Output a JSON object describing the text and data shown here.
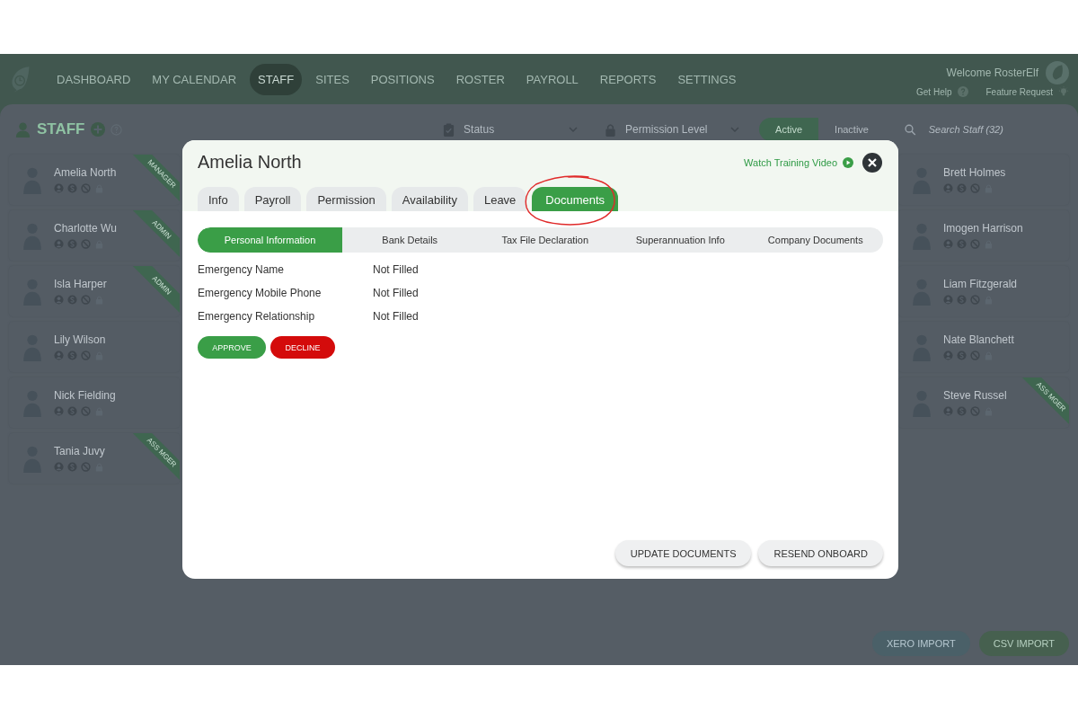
{
  "nav": {
    "items": [
      {
        "label": "DASHBOARD",
        "selected": false
      },
      {
        "label": "MY CALENDAR",
        "selected": false
      },
      {
        "label": "STAFF",
        "selected": true
      },
      {
        "label": "SITES",
        "selected": false
      },
      {
        "label": "POSITIONS",
        "selected": false
      },
      {
        "label": "ROSTER",
        "selected": false
      },
      {
        "label": "PAYROLL",
        "selected": false
      },
      {
        "label": "REPORTS",
        "selected": false
      },
      {
        "label": "SETTINGS",
        "selected": false
      }
    ],
    "welcome": "Welcome RosterElf",
    "help": "Get Help",
    "feature_request": "Feature Request"
  },
  "staff_header": {
    "title": "STAFF",
    "status_filter": "Status",
    "permission_filter": "Permission Level",
    "toggle": [
      {
        "label": "Active",
        "selected": true
      },
      {
        "label": "Inactive",
        "selected": false
      }
    ],
    "search": {
      "placeholder": "Search Staff (32)"
    }
  },
  "staff_left": [
    {
      "name": "Amelia North",
      "ribbon": "MANAGER"
    },
    {
      "name": "Charlotte Wu",
      "ribbon": "ADMIN"
    },
    {
      "name": "Isla Harper",
      "ribbon": "ADMIN"
    },
    {
      "name": "Lily Wilson"
    },
    {
      "name": "Nick Fielding"
    },
    {
      "name": "Tania Juvy",
      "ribbon": "ASS MGER"
    }
  ],
  "staff_right": [
    {
      "name": "Brett Holmes"
    },
    {
      "name": "Imogen Harrison"
    },
    {
      "name": "Liam Fitzgerald"
    },
    {
      "name": "Nate Blanchett"
    },
    {
      "name": "Steve Russel",
      "ribbon": "ASS MGER"
    }
  ],
  "import_buttons": [
    {
      "label": "XERO IMPORT",
      "kind": "xero"
    },
    {
      "label": "CSV IMPORT",
      "kind": "csv"
    }
  ],
  "dialog": {
    "title": "Amelia North",
    "training_link": "Watch Training Video",
    "tabs": [
      {
        "label": "Info",
        "selected": false,
        "circled": false
      },
      {
        "label": "Payroll",
        "selected": false,
        "circled": false
      },
      {
        "label": "Permission",
        "selected": false,
        "circled": false
      },
      {
        "label": "Availability",
        "selected": false,
        "circled": false
      },
      {
        "label": "Leave",
        "selected": false,
        "circled": false
      },
      {
        "label": "Documents",
        "selected": true,
        "circled": true
      }
    ],
    "subtabs": [
      {
        "label": "Personal Information",
        "selected": true
      },
      {
        "label": "Bank Details",
        "selected": false
      },
      {
        "label": "Tax File Declaration",
        "selected": false
      },
      {
        "label": "Superannuation Info",
        "selected": false
      },
      {
        "label": "Company Documents",
        "selected": false
      }
    ],
    "fields": [
      {
        "label": "Emergency Name",
        "value": "Not Filled"
      },
      {
        "label": "Emergency Mobile Phone",
        "value": "Not Filled"
      },
      {
        "label": "Emergency Relationship",
        "value": "Not Filled"
      }
    ],
    "actions": [
      {
        "label": "APPROVE",
        "kind": "approve"
      },
      {
        "label": "DECLINE",
        "kind": "decline"
      }
    ],
    "footer_buttons": [
      "UPDATE DOCUMENTS",
      "RESEND ONBOARD"
    ]
  }
}
